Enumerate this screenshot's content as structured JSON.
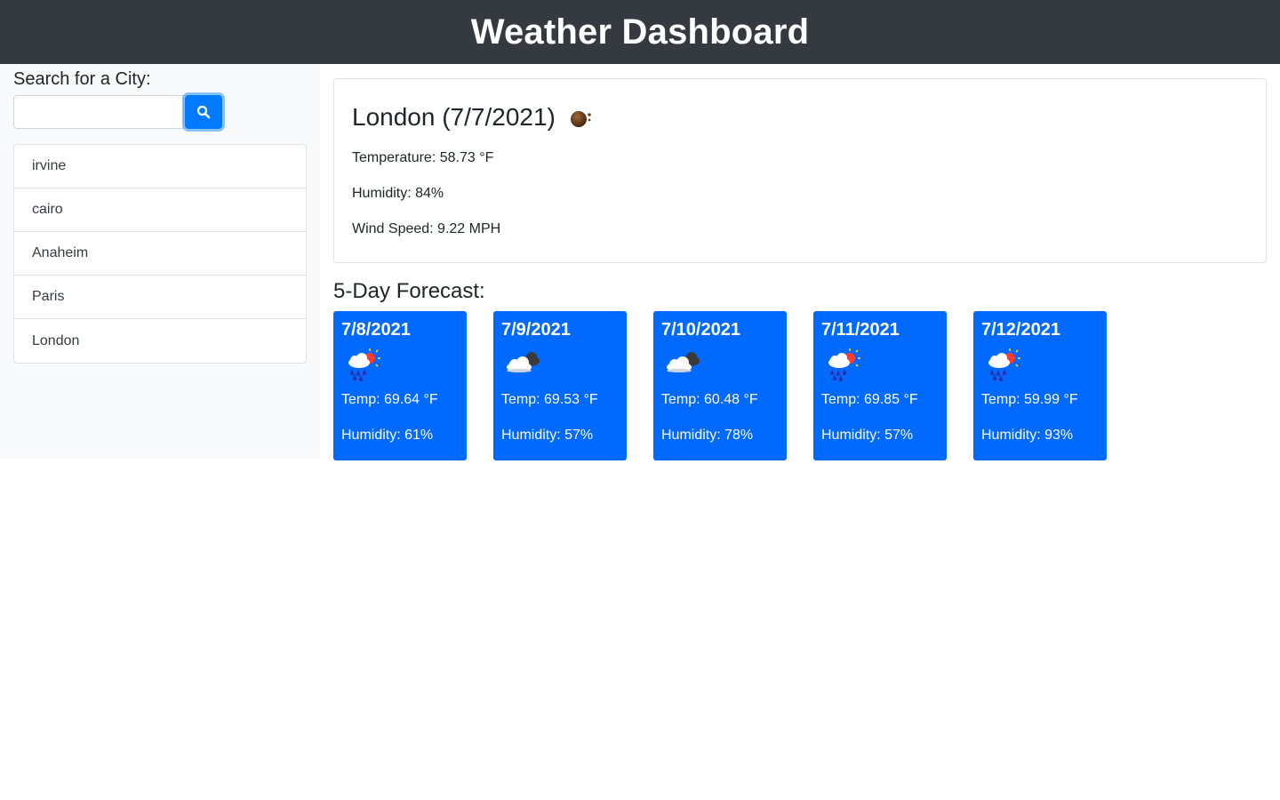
{
  "header": {
    "title": "Weather Dashboard"
  },
  "sidebar": {
    "search_label": "Search for a City:",
    "search_value": "",
    "search_placeholder": "",
    "history": [
      {
        "label": "irvine"
      },
      {
        "label": "cairo"
      },
      {
        "label": "Anaheim"
      },
      {
        "label": "Paris"
      },
      {
        "label": "London"
      }
    ]
  },
  "current": {
    "title": "London (7/7/2021)",
    "icon": "dark-cloud-icon",
    "temperature": "Temperature: 58.73 °F",
    "humidity": "Humidity: 84%",
    "wind": "Wind Speed: 9.22 MPH"
  },
  "forecast": {
    "heading": "5-Day Forecast:",
    "days": [
      {
        "date": "7/8/2021",
        "icon": "rain-sun-icon",
        "temp": "Temp: 69.64 °F",
        "humidity": "Humidity: 61%"
      },
      {
        "date": "7/9/2021",
        "icon": "broken-clouds-icon",
        "temp": "Temp: 69.53 °F",
        "humidity": "Humidity: 57%"
      },
      {
        "date": "7/10/2021",
        "icon": "broken-clouds-icon",
        "temp": "Temp: 60.48 °F",
        "humidity": "Humidity: 78%"
      },
      {
        "date": "7/11/2021",
        "icon": "rain-sun-icon",
        "temp": "Temp: 69.85 °F",
        "humidity": "Humidity: 57%"
      },
      {
        "date": "7/12/2021",
        "icon": "rain-sun-icon",
        "temp": "Temp: 59.99 °F",
        "humidity": "Humidity: 93%"
      }
    ]
  },
  "colors": {
    "header_bg": "#343a40",
    "accent": "#007bff",
    "card_bg": "#0069ff",
    "sidebar_bg": "#f8f9fa"
  }
}
